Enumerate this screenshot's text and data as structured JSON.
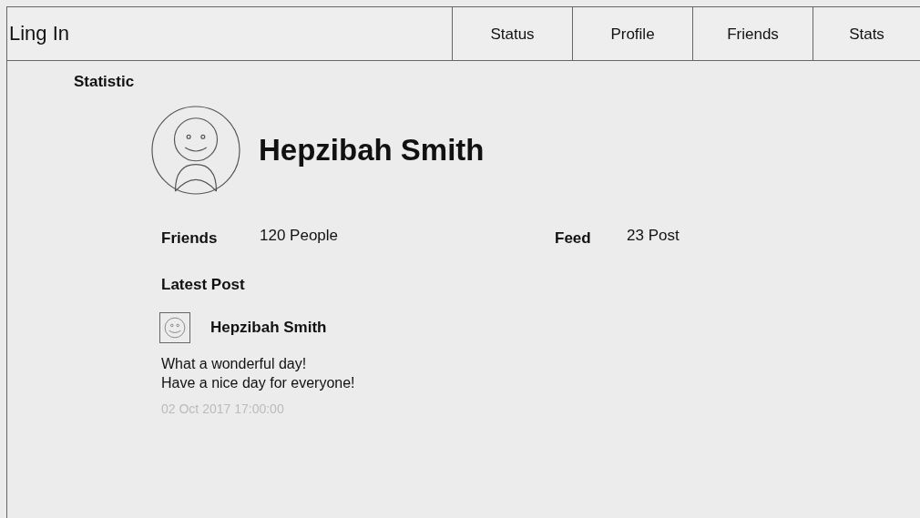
{
  "app": {
    "title": "Ling In"
  },
  "tabs": [
    {
      "label": "Status"
    },
    {
      "label": "Profile"
    },
    {
      "label": "Friends"
    },
    {
      "label": "Stats"
    }
  ],
  "page": {
    "heading": "Statistic"
  },
  "profile": {
    "name": "Hepzibah Smith"
  },
  "stats": [
    {
      "label": "Friends",
      "value": "120 People"
    },
    {
      "label": "Feed",
      "value": "23 Post"
    }
  ],
  "latest_post": {
    "heading": "Latest Post",
    "author": "Hepzibah Smith",
    "text": "What a wonderful day!\nHave a nice day for everyone!",
    "time": "02 Oct 2017 17:00:00"
  }
}
